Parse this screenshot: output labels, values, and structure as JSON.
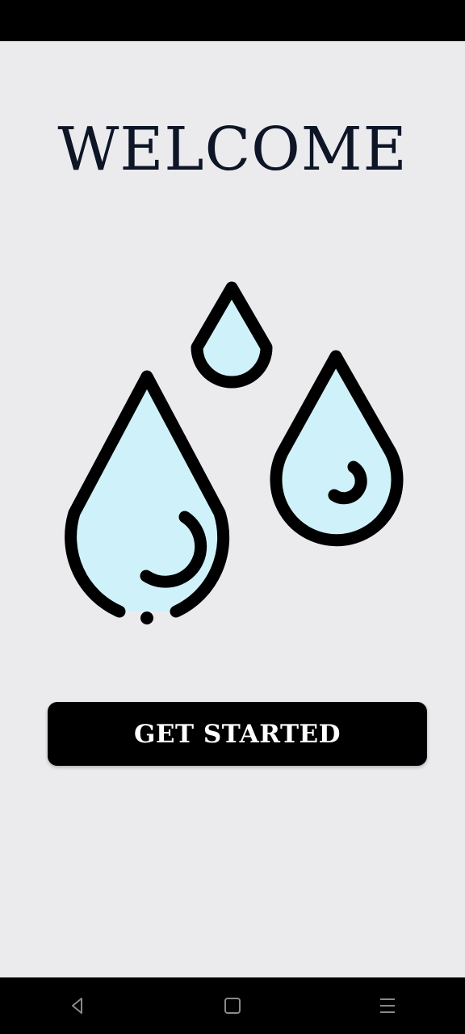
{
  "welcome": {
    "title": "WELCOME",
    "cta_label": "GET STARTED"
  },
  "illustration": {
    "icon": "water-drops-icon",
    "fill_color": "#cff2fa",
    "stroke_color": "#000000"
  },
  "colors": {
    "background": "#ebebee",
    "title_text": "#0d1526",
    "button_background": "#000000",
    "button_text": "#ffffff"
  },
  "system_nav": {
    "items": [
      {
        "icon": "back-icon"
      },
      {
        "icon": "home-icon"
      },
      {
        "icon": "menu-icon"
      }
    ]
  }
}
